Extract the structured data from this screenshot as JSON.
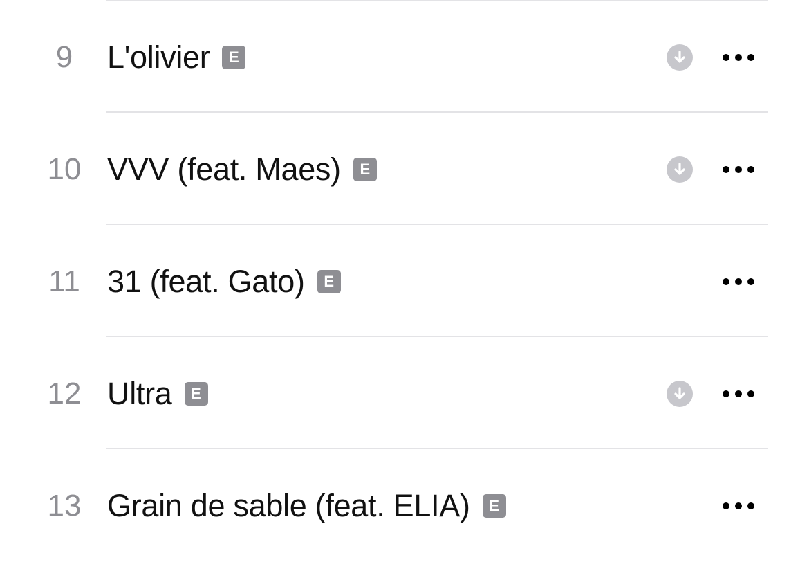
{
  "tracks": [
    {
      "number": "9",
      "title": "L'olivier",
      "explicit_label": "E",
      "downloaded": true
    },
    {
      "number": "10",
      "title": "VVV (feat. Maes)",
      "explicit_label": "E",
      "downloaded": true
    },
    {
      "number": "11",
      "title": "31 (feat. Gato)",
      "explicit_label": "E",
      "downloaded": false
    },
    {
      "number": "12",
      "title": "Ultra",
      "explicit_label": "E",
      "downloaded": true
    },
    {
      "number": "13",
      "title": "Grain de sable (feat. ELIA)",
      "explicit_label": "E",
      "downloaded": false
    }
  ],
  "icons": {
    "download": "arrow-down-circle-icon",
    "more": "ellipsis-icon",
    "explicit": "explicit-badge"
  },
  "colors": {
    "track_number": "#8e8e93",
    "title": "#111111",
    "explicit_badge": "#8e8e93",
    "download_icon": "#c7c7cc",
    "more_icon": "#000000",
    "divider": "#e3e3e6"
  }
}
